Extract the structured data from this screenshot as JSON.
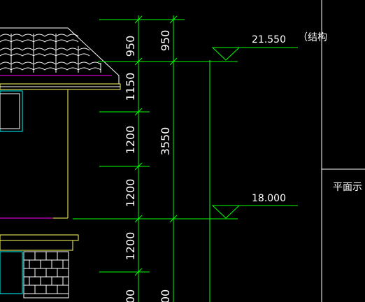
{
  "dimensions": {
    "col1": [
      "950",
      "1150",
      "1200",
      "1200",
      "1200",
      "00"
    ],
    "col2": [
      "950",
      "3550",
      "00"
    ]
  },
  "levels": {
    "upper": "21.550",
    "lower": "18.000"
  },
  "notes": {
    "structure": "（结构",
    "plan": "平面示"
  },
  "colors": {
    "background": "#000000",
    "dimension_line": "#00ff00",
    "text": "#ffffff",
    "roof_tile": "#ffffff",
    "building_edge": "#ffff66",
    "window": "#00ffff",
    "eave_magenta": "#ff00ff"
  }
}
